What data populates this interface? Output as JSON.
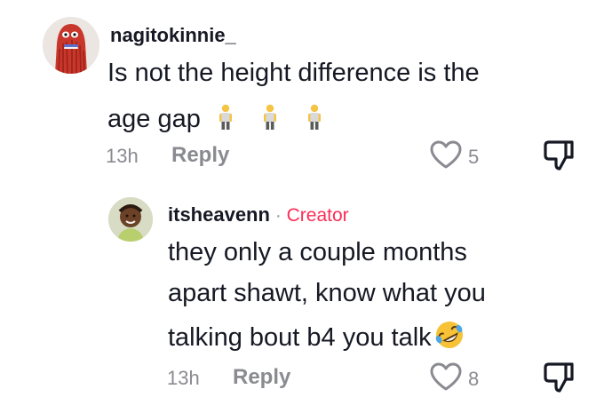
{
  "comments": [
    {
      "username": "nagitokinnie_",
      "text_line1": "Is not the height difference is the",
      "text_line2": "age gap",
      "emoji_icons": [
        "person-standing-icon",
        "person-standing-icon",
        "person-standing-icon"
      ],
      "time": "13h",
      "reply_label": "Reply",
      "like_count": "5",
      "avatar_icon": "red-monster-avatar"
    }
  ],
  "reply": {
    "username": "itsheavenn",
    "separator": "·",
    "creator_label": "Creator",
    "text_line1": "they only a couple months",
    "text_line2": "apart shawt, know what you",
    "text_line3": "talking bout b4 you talk",
    "emoji_icon": "rolling-on-floor-laughing-icon",
    "time": "13h",
    "reply_label": "Reply",
    "like_count": "8",
    "avatar_icon": "child-photo-avatar"
  },
  "colors": {
    "text": "#161823",
    "muted": "#8a8b91",
    "creator": "#fe2c55"
  }
}
